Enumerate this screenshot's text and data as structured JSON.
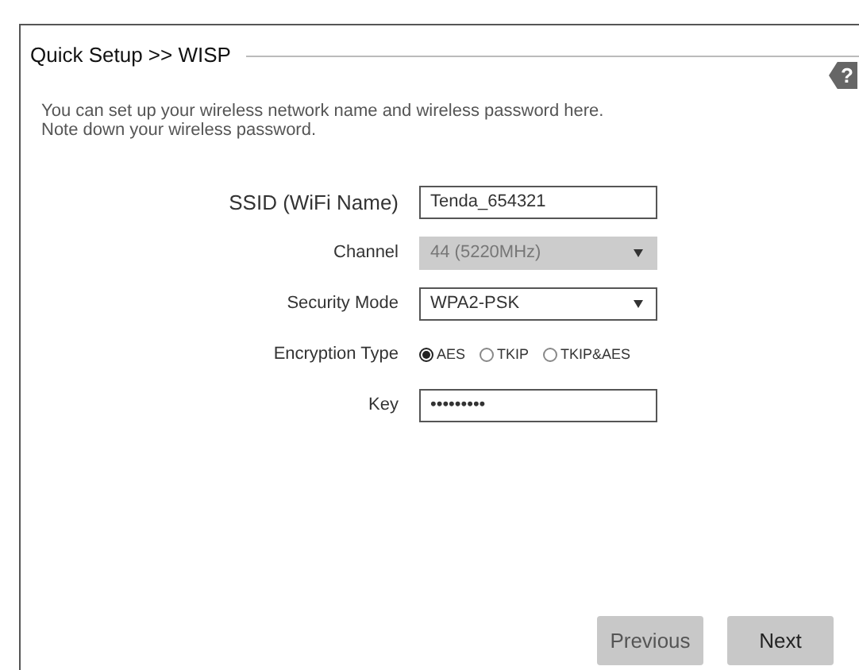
{
  "panel": {
    "title": "Quick Setup >> WISP",
    "help": "?"
  },
  "description": [
    "You can set up your wireless network name and wireless password here.",
    "Note down your wireless password."
  ],
  "fields": [
    {
      "kind": "text",
      "label": "SSID (WiFi Name)",
      "value": "Tenda_654321",
      "disabled": false
    },
    {
      "kind": "select",
      "label": "Channel",
      "value": "44 (5220MHz)",
      "disabled": true
    },
    {
      "kind": "select",
      "label": "Security Mode",
      "value": "WPA2-PSK",
      "disabled": false
    },
    {
      "kind": "radio",
      "label": "Encryption Type",
      "options": [
        {
          "label": "AES",
          "selected": true
        },
        {
          "label": "TKIP",
          "selected": false
        },
        {
          "label": "TKIP&AES",
          "selected": false
        }
      ]
    },
    {
      "kind": "text",
      "label": "Key",
      "value": "•••••••••",
      "disabled": false
    }
  ],
  "buttons": [
    "Previous",
    "Next"
  ]
}
